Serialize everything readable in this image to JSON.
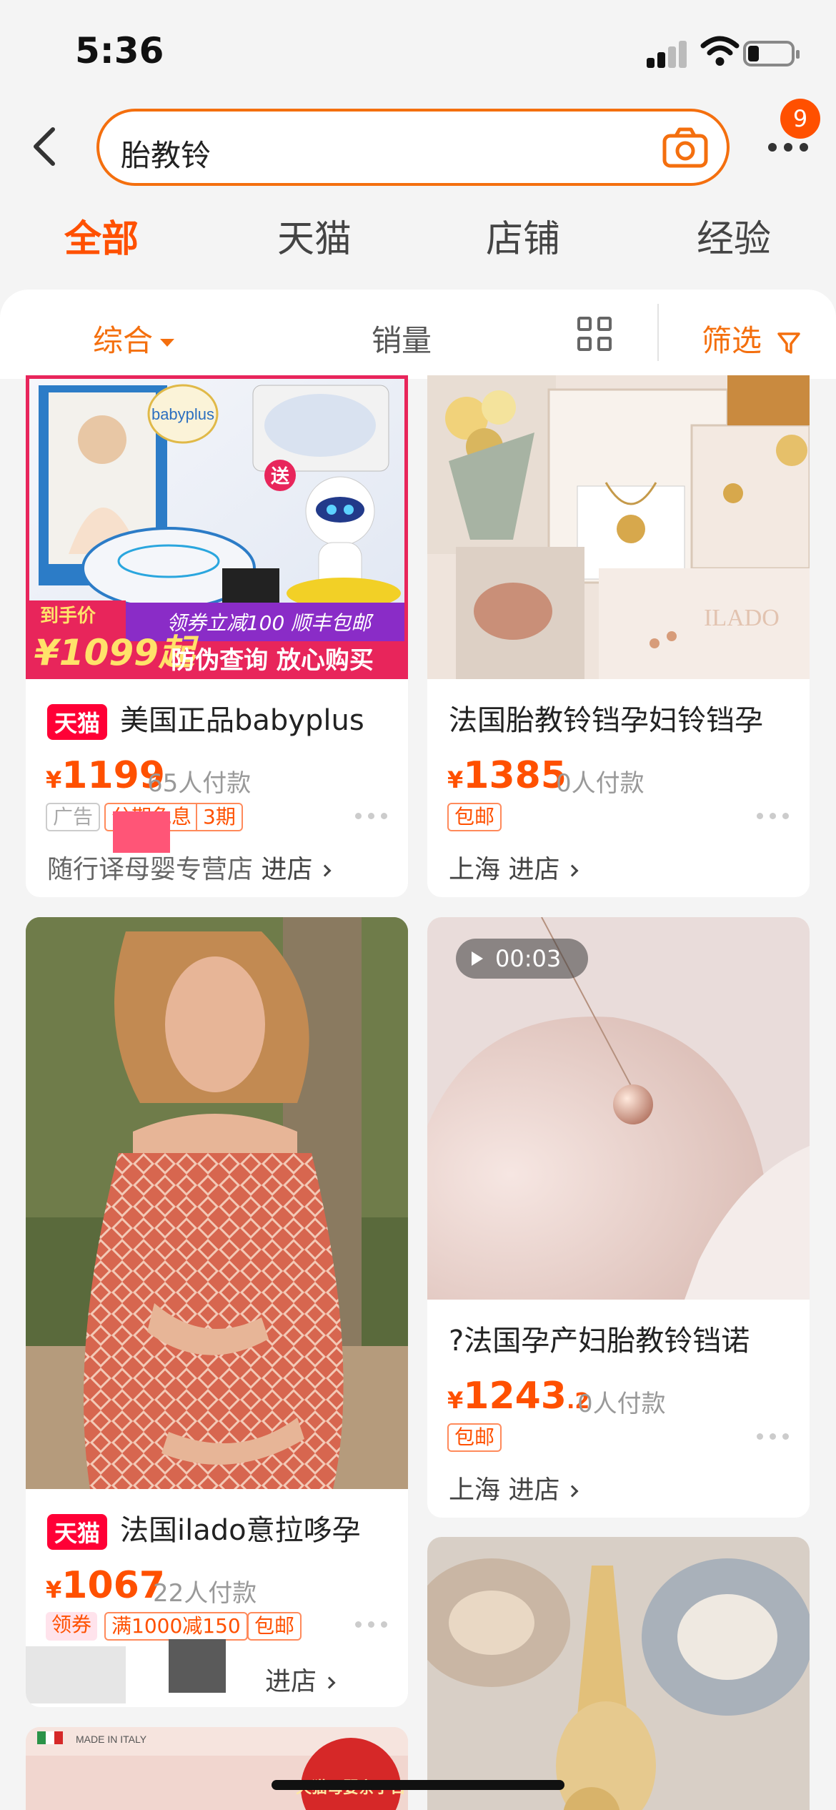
{
  "status": {
    "time": "5:36"
  },
  "search": {
    "query": "胎教铃",
    "cart_badge": "9"
  },
  "tabs": [
    "全部",
    "天猫",
    "店铺",
    "经验"
  ],
  "sort": {
    "comprehensive": "综合",
    "sales": "销量",
    "filter": "筛选"
  },
  "products": [
    {
      "tmall_badge": "天猫",
      "title": "美国正品babyplus",
      "currency": "¥",
      "price": "1199",
      "paid": "65人付款",
      "tags": [
        "广告",
        "分期免息",
        "3期"
      ],
      "shop": "随行译母婴专营店",
      "shop_link": "进店",
      "image_text": {
        "brand": "babyplus",
        "gift": "送",
        "promo": "领券立减100 顺丰包邮",
        "handprice_label": "到手价",
        "handprice": "¥1099起",
        "slogan": "防伪查询 放心购买"
      }
    },
    {
      "title": "法国胎教铃铛孕妇铃铛孕",
      "currency": "¥",
      "price": "1385",
      "paid": "0人付款",
      "tags": [
        "包邮"
      ],
      "shop": "上海",
      "shop_link": "进店",
      "image_text": {
        "brand": "ILADO"
      }
    },
    {
      "tmall_badge": "天猫",
      "title": "法国ilado意拉哆孕",
      "currency": "¥",
      "price": "1067",
      "paid": "22人付款",
      "tags": [
        "领券",
        "满1000减150",
        "包邮"
      ],
      "shop_link": "进店"
    },
    {
      "video_duration": "00:03",
      "title": "?法国孕产妇胎教铃铛诺",
      "currency": "¥",
      "price": "1243",
      "price_decimal": ".2",
      "paid": "0人付款",
      "tags": [
        "包邮"
      ],
      "shop": "上海",
      "shop_link": "进店"
    },
    {
      "image_text": {
        "origin": "MADE IN ITALY",
        "banner": "天猫母婴亲子日"
      }
    }
  ],
  "colors": {
    "accent": "#ff5000",
    "tmall": "#ff0036",
    "border": "#f46f0e"
  }
}
